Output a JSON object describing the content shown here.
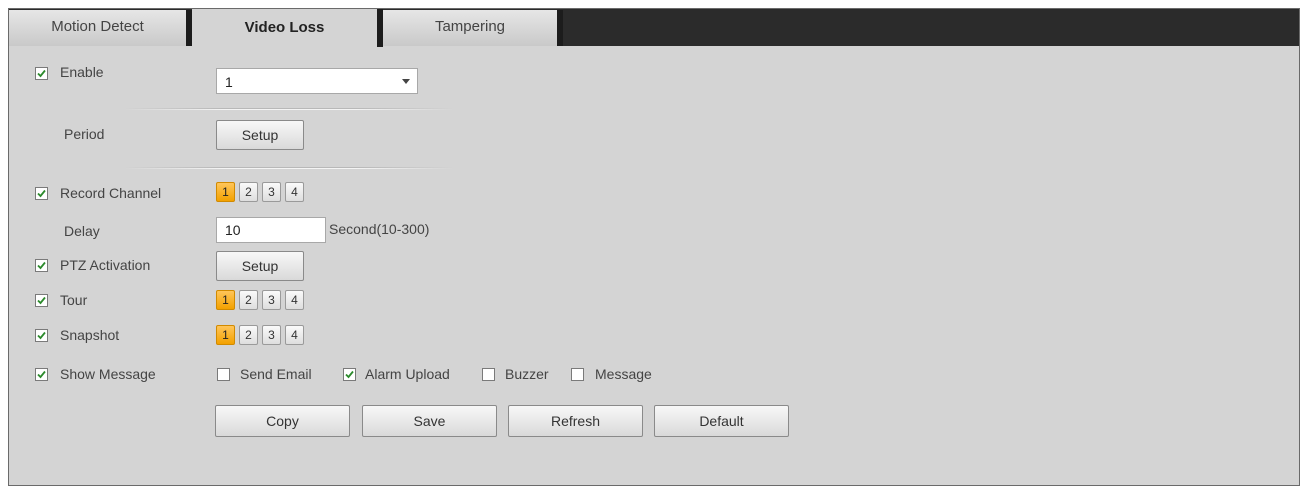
{
  "tabs": [
    {
      "label": "Motion Detect",
      "active": false
    },
    {
      "label": "Video Loss",
      "active": true
    },
    {
      "label": "Tampering",
      "active": false
    }
  ],
  "enable": {
    "label": "Enable",
    "checked": true,
    "channel_value": "1"
  },
  "period": {
    "label": "Period",
    "button": "Setup"
  },
  "record_channel": {
    "label": "Record Channel",
    "checked": true,
    "channels": [
      "1",
      "2",
      "3",
      "4"
    ],
    "selected": "1"
  },
  "delay": {
    "label": "Delay",
    "value": "10",
    "unit": "Second(10-300)"
  },
  "ptz": {
    "label": "PTZ Activation",
    "checked": true,
    "button": "Setup"
  },
  "tour": {
    "label": "Tour",
    "checked": true,
    "channels": [
      "1",
      "2",
      "3",
      "4"
    ],
    "selected": "1"
  },
  "snapshot": {
    "label": "Snapshot",
    "checked": true,
    "channels": [
      "1",
      "2",
      "3",
      "4"
    ],
    "selected": "1"
  },
  "show_message": {
    "label": "Show Message",
    "checked": true
  },
  "options": {
    "send_email": {
      "label": "Send Email",
      "checked": false
    },
    "alarm_upload": {
      "label": "Alarm Upload",
      "checked": true
    },
    "buzzer": {
      "label": "Buzzer",
      "checked": false
    },
    "message": {
      "label": "Message",
      "checked": false
    }
  },
  "actions": {
    "copy": "Copy",
    "save": "Save",
    "refresh": "Refresh",
    "default": "Default"
  },
  "icons": {
    "check": "check-icon",
    "dropdown": "chevron-down-icon"
  },
  "colors": {
    "selected_channel": "#f3a100",
    "check": "#2b8a2b",
    "panel": "#d4d4d4",
    "tabbar": "#2b2b2b"
  }
}
